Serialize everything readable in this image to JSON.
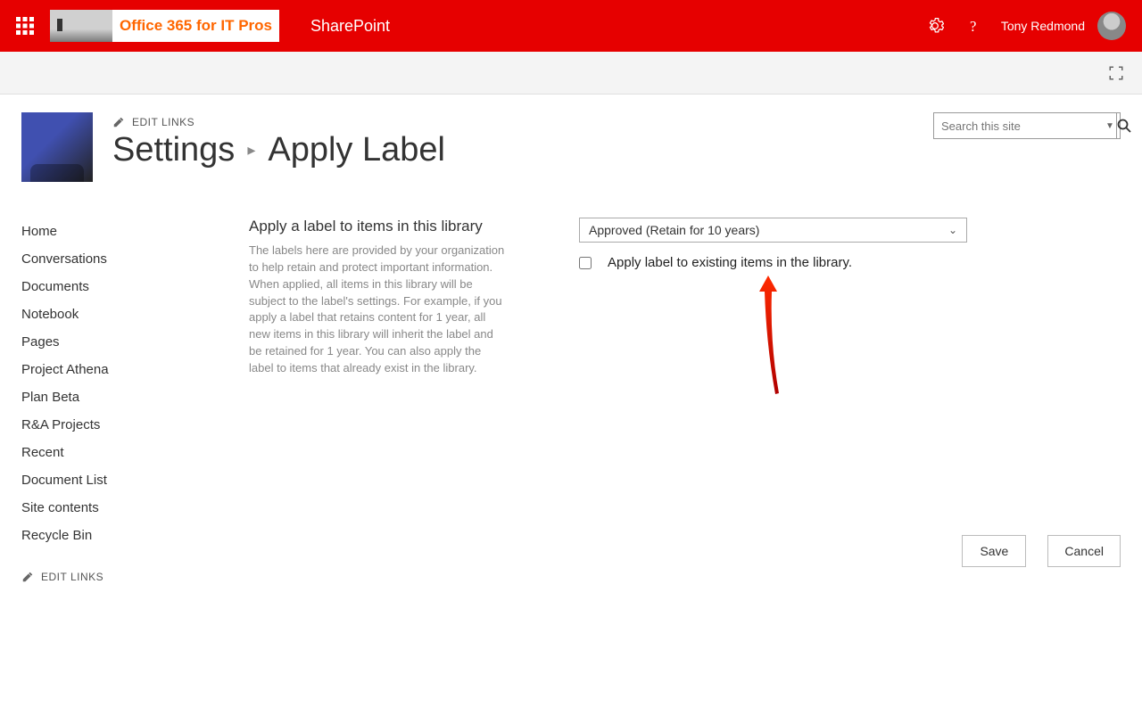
{
  "top": {
    "logo_text": "Office 365 for IT Pros",
    "app_name": "SharePoint",
    "user_name": "Tony Redmond"
  },
  "header": {
    "edit_links": "EDIT LINKS",
    "breadcrumb_parent": "Settings",
    "breadcrumb_current": "Apply Label"
  },
  "search": {
    "placeholder": "Search this site"
  },
  "nav": {
    "items": [
      "Home",
      "Conversations",
      "Documents",
      "Notebook",
      "Pages",
      "Project Athena",
      "Plan Beta",
      "R&A Projects",
      "Recent",
      "Document List",
      "Site contents",
      "Recycle Bin"
    ],
    "edit_links": "EDIT LINKS"
  },
  "desc": {
    "title": "Apply a label to items in this library",
    "body": "The labels here are provided by your organization to help retain and protect important information. When applied, all items in this library will be subject to the label's settings. For example, if you apply a label that retains content for 1 year, all new items in this library will inherit the label and be retained for 1 year. You can also apply the label to items that already exist in the library."
  },
  "form": {
    "selected_label": "Approved (Retain for 10 years)",
    "checkbox_label": "Apply label to existing items in the library.",
    "save": "Save",
    "cancel": "Cancel"
  }
}
